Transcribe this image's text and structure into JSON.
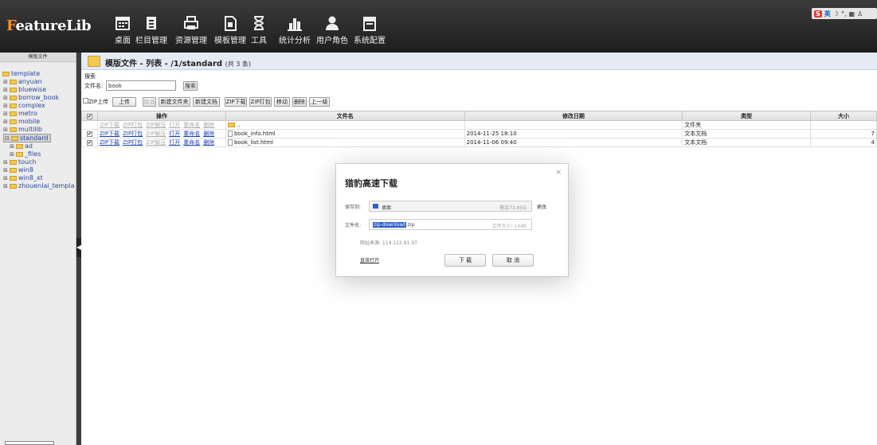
{
  "app": {
    "logo_prefix": "F",
    "logo_rest": "eatureLib"
  },
  "nav": [
    {
      "icon": "calendar-icon",
      "label": "桌面"
    },
    {
      "icon": "document-icon",
      "label": "栏目管理"
    },
    {
      "icon": "printer-icon",
      "label": "资源管理"
    },
    {
      "icon": "template-icon",
      "label": "模板管理"
    },
    {
      "icon": "hourglass-icon",
      "label": "工具"
    },
    {
      "icon": "bar-chart-icon",
      "label": "统计分析"
    },
    {
      "icon": "user-icon",
      "label": "用户角色"
    },
    {
      "icon": "monitor-icon",
      "label": "系统配置"
    }
  ],
  "ime": {
    "brand": "S",
    "mode": "英"
  },
  "sidebar": {
    "header": "模版文件",
    "items": [
      "template",
      "anyuan",
      "bluewise",
      "borrow_book",
      "complex",
      "metro",
      "mobile",
      "multilib",
      "standard",
      "ad",
      "_files",
      "touch",
      "win8",
      "win8_xt",
      "zhouenlai_templa"
    ]
  },
  "main": {
    "title": "模版文件 - 列表 - /1/standard",
    "count": "(共 3 条)"
  },
  "search": {
    "label": "搜索",
    "field_label": "文件名:",
    "value": "book",
    "button": "搜索"
  },
  "toolbar": {
    "zip_upload": "ZIP上传",
    "upload": "上传",
    "cancel": "取消",
    "new_folder": "新建文件夹",
    "new_file": "新建文档",
    "zip_download": "ZIP下载",
    "zip_pack": "ZIP打包",
    "move": "移动",
    "delete": "删除",
    "up": "上一级"
  },
  "table": {
    "headers": {
      "ops": "操作",
      "name": "文件名",
      "date": "修改日期",
      "type": "类型",
      "size": "大小"
    },
    "ops": [
      "ZIP下载",
      "ZIP打包",
      "ZIP解压",
      "打开",
      "重命名",
      "删除"
    ],
    "rows": [
      {
        "name": "..",
        "date": "",
        "type": "文件夹",
        "size": "",
        "checked": false
      },
      {
        "name": "book_info.html",
        "date": "2014-11-25 18:10",
        "type": "文本文档",
        "size": "7",
        "checked": true
      },
      {
        "name": "book_list.html",
        "date": "2014-11-06 09:40",
        "type": "文本文档",
        "size": "4",
        "checked": true
      }
    ]
  },
  "dialog": {
    "title": "猎豹高速下载",
    "save_to_label": "保存到:",
    "save_to_value": "桌面",
    "free_space": "剩余73.95G",
    "change": "更改",
    "filename_label": "文件名:",
    "filename_sel": "zip-download",
    "filename_ext": ".zip",
    "filesize": "文件大小: 144B",
    "source": "网址来源: 114.112.91.97",
    "direct_open": "直接打开",
    "download": "下 载",
    "cancel": "取 消",
    "close": "×"
  }
}
